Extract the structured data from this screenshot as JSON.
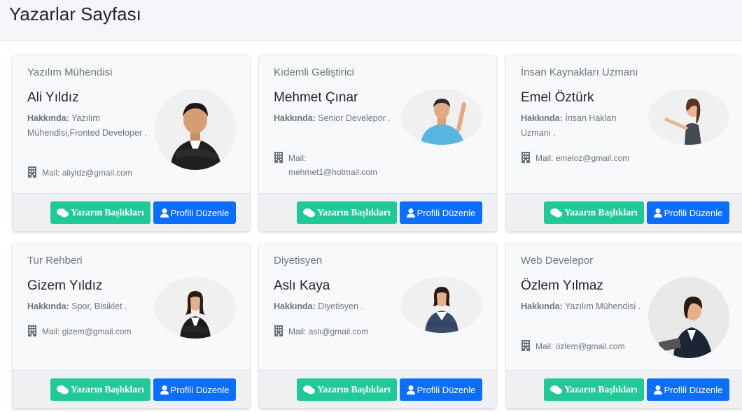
{
  "page": {
    "title": "Yazarlar Sayfası"
  },
  "labels": {
    "about": "Hakkında:",
    "mail": "Mail:",
    "titles_button": "Yazarın Başlıkları",
    "edit_button": "Profili Düzenle"
  },
  "colors": {
    "green": "#20c997",
    "blue": "#0d6efd"
  },
  "authors": [
    {
      "role": "Yazılım Mühendisi",
      "name": "Ali Yıldız",
      "about": "Yazılım Mühendisi,Fronted Developer .",
      "email": "aliyldz@gmail.com",
      "avatar": "man-suit-arms-crossed"
    },
    {
      "role": "Kıdemli Geliştirici",
      "name": "Mehmet Çınar",
      "about": "Senior Develepor .",
      "email": "mehmet1@hotmail.com",
      "avatar": "man-blue-shirt-pointing"
    },
    {
      "role": "İnsan Kaynakları Uzmanı",
      "name": "Emel Öztürk",
      "about": "İnsan Hakları Uzmanı .",
      "email": "emeloz@gmail.com",
      "avatar": "woman-presenting"
    },
    {
      "role": "Tur Rehberi",
      "name": "Gizem Yıldız",
      "about": "Spor, Bisiklet .",
      "email": "gizem@gmail.com",
      "avatar": "woman-suit-arms-crossed"
    },
    {
      "role": "Diyetisyen",
      "name": "Aslı Kaya",
      "about": "Diyetisyen .",
      "email": "aslı@gmail.com",
      "avatar": "woman-arms-crossed"
    },
    {
      "role": "Web Develepor",
      "name": "Özlem Yılmaz",
      "about": "Yazılım Mühendisi .",
      "email": "özlem@gmail.com",
      "avatar": "woman-with-tablet"
    }
  ]
}
